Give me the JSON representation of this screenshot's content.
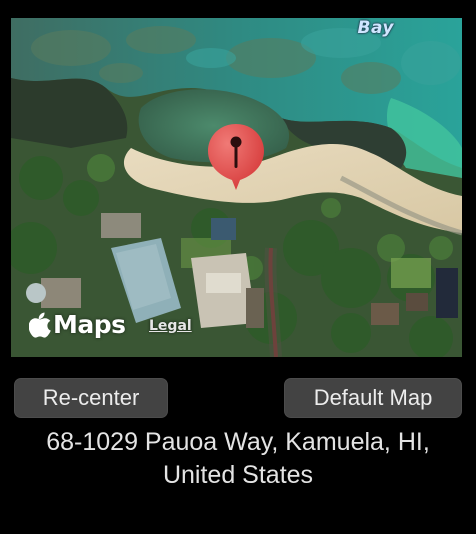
{
  "map": {
    "water_label": "Bay",
    "brand_label": "Maps",
    "legal_label": "Legal",
    "pin_icon": "map-pin-icon",
    "pin_color": "#e04848"
  },
  "controls": {
    "recenter_label": "Re-center",
    "default_map_label": "Default Map"
  },
  "address": {
    "line1": "68-1029 Pauoa Way, Kamuela, HI,",
    "line2": "United States"
  }
}
